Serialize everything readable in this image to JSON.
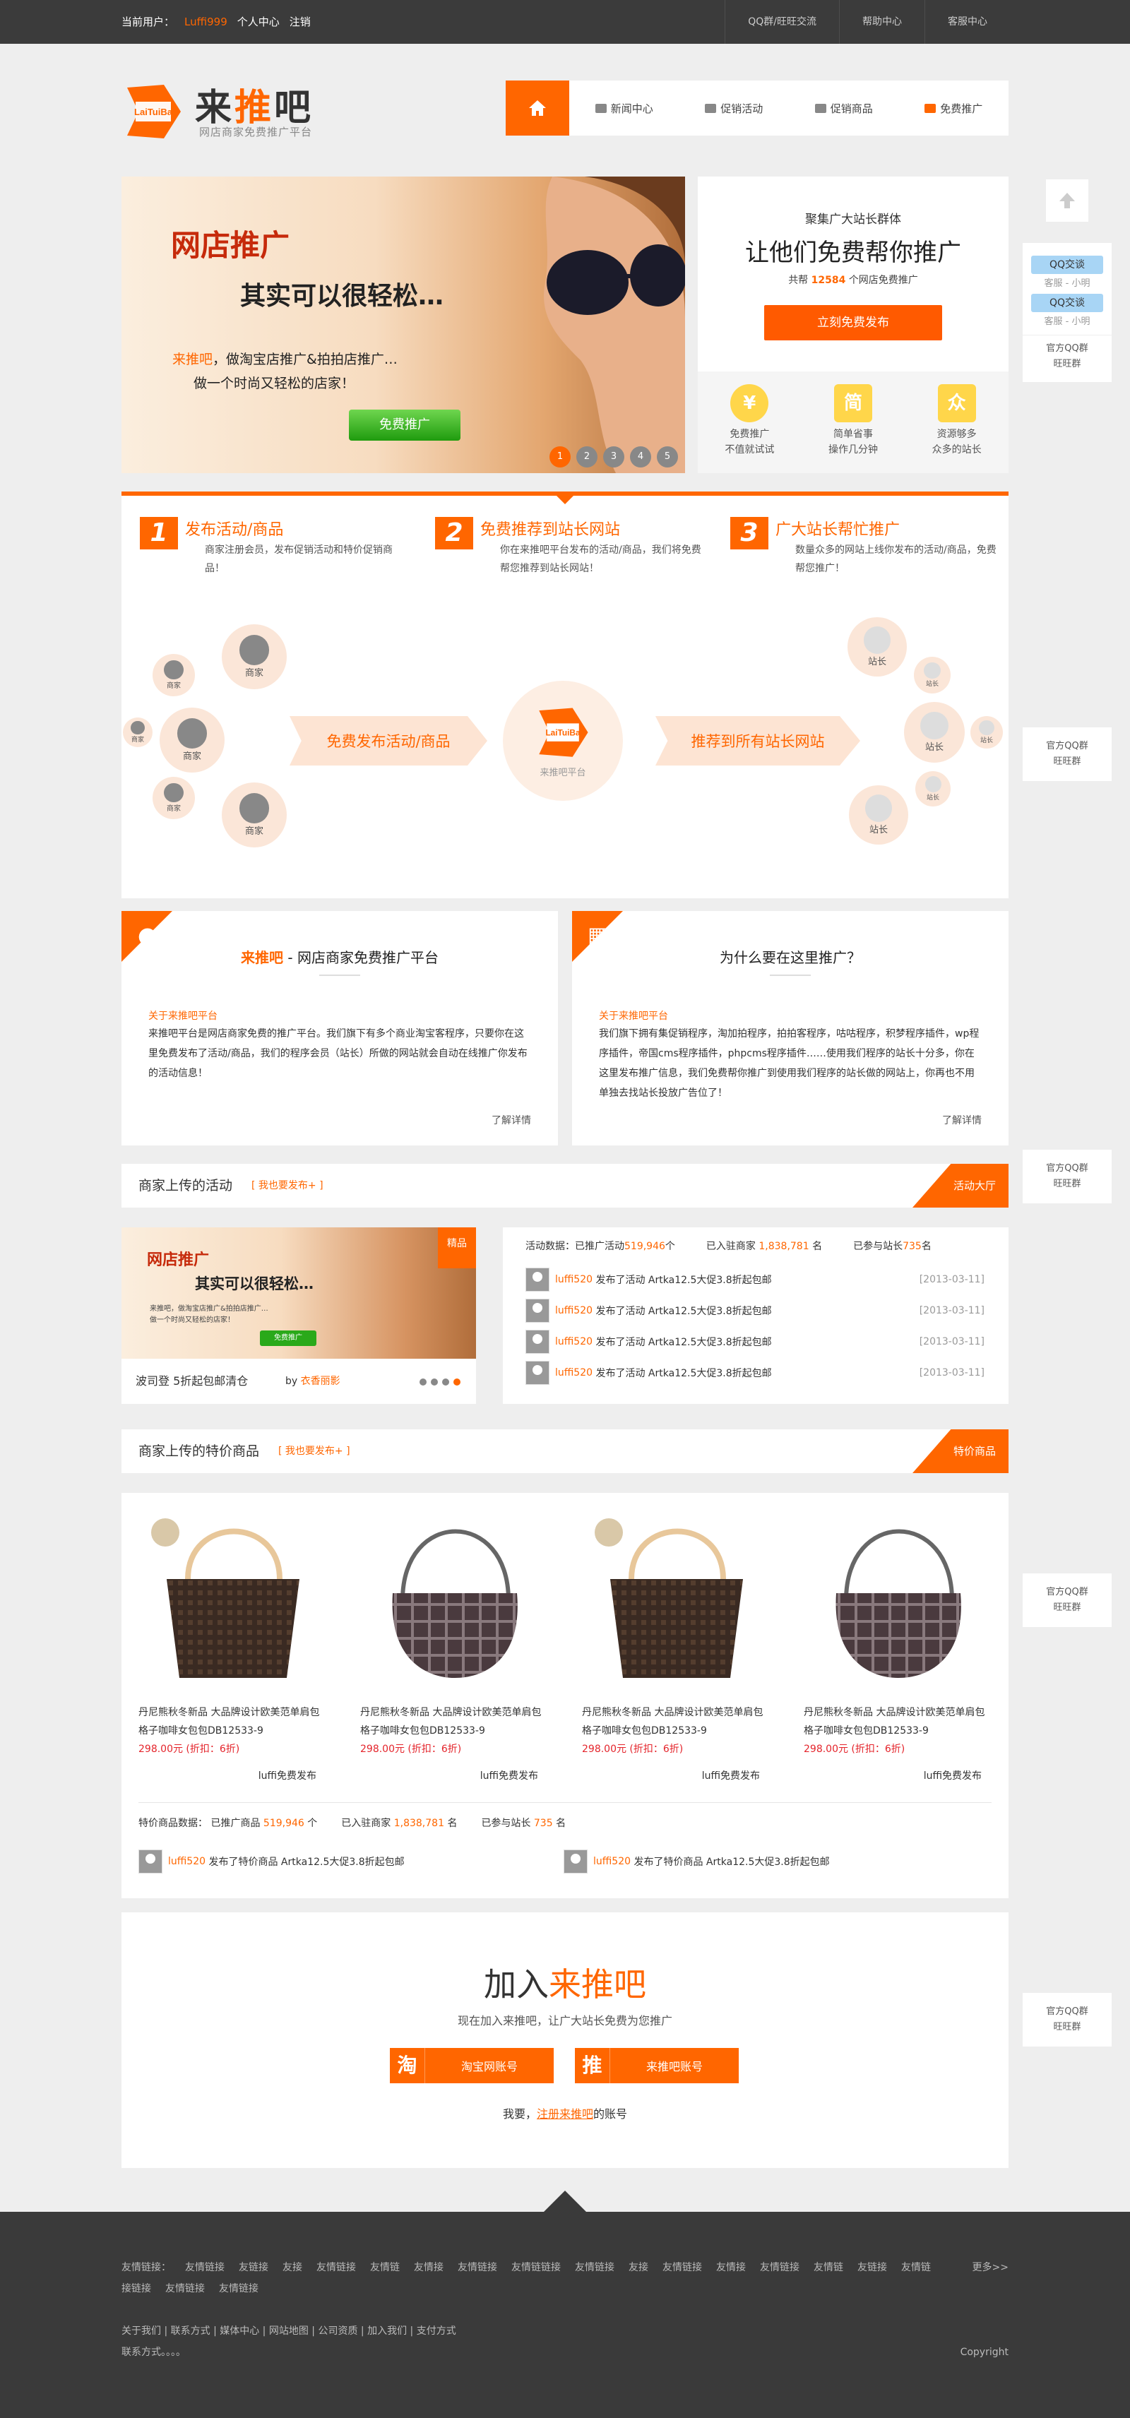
{
  "topbar": {
    "user_label": "当前用户：",
    "username": "Luffi999",
    "profile": "个人中心",
    "logout": "注销",
    "links": [
      "QQ群/旺旺交流",
      "帮助中心",
      "客服中心"
    ]
  },
  "logo": {
    "mark_text": "LaiTuiBa",
    "name_part1": "来",
    "name_part2": "推",
    "name_part3": "吧",
    "subtitle": "网店商家免费推广平台"
  },
  "nav": {
    "items": [
      "新闻中心",
      "促销活动",
      "促销商品",
      "免费推广"
    ]
  },
  "banner": {
    "title": "网店推广",
    "subtitle": "其实可以很轻松…",
    "line1_highlight": "来推吧",
    "line1_rest": "，做淘宝店推广&拍拍店推广…",
    "line2": "做一个时尚又轻松的店家！",
    "button": "免费推广",
    "pages": [
      "1",
      "2",
      "3",
      "4",
      "5"
    ]
  },
  "promo": {
    "kicker": "聚集广大站长群体",
    "headline": "让他们免费帮你推广",
    "count_prefix": "共帮",
    "count": "12584",
    "count_suffix": "个网店免费推广",
    "button": "立刻免费发布",
    "features": [
      {
        "icon": "¥",
        "line1": "免费推广",
        "line2": "不值就试试"
      },
      {
        "icon": "简",
        "line1": "简单省事",
        "line2": "操作几分钟"
      },
      {
        "icon": "众",
        "line1": "资源够多",
        "line2": "众多的站长"
      }
    ]
  },
  "steps": {
    "items": [
      {
        "num": "1",
        "title": "发布活动/商品",
        "desc": "商家注册会员，发布促销活动和特价促销商品！"
      },
      {
        "num": "2",
        "title": "免费推荐到站长网站",
        "desc": "你在来推吧平台发布的活动/商品，我们将免费帮您推荐到站长网站！"
      },
      {
        "num": "3",
        "title": "广大站长帮忙推广",
        "desc": "数量众多的网站上线你发布的活动/商品，免费帮您推广！"
      }
    ],
    "merchant": "商家",
    "webmaster": "站长",
    "band1": "免费发布活动/商品",
    "band2": "推荐到所有站长网站",
    "platform": "来推吧平台",
    "platform_mark": "LaiTuiBa"
  },
  "cards": [
    {
      "title_brand": "来推吧",
      "title_rest": " - 网店商家免费推广平台",
      "heading": "关于来推吧平台",
      "body": "来推吧平台是网店商家免费的推广平台。我们旗下有多个商业淘宝客程序，只要你在这里免费发布了活动/商品，我们的程序会员（站长）所做的网站就会自动在线推广你发布的活动信息！",
      "more": "了解详情"
    },
    {
      "title": "为什么要在这里推广？",
      "heading": "关于来推吧平台",
      "body": "我们旗下拥有集促销程序，淘加拍程序，拍拍客程序，咕咕程序，积梦程序插件，wp程序插件，帝国cms程序插件，phpcms程序插件……使用我们程序的站长十分多，你在这里发布推广信息，我们免费帮你推广到使用我们程序的站长做的网站上，你再也不用单独去找站长投放广告位了！",
      "more": "了解详情"
    }
  ],
  "activities": {
    "title": "商家上传的活动",
    "post_link": "[ 我也要发布+ ]",
    "tag": "活动大厅",
    "banner": {
      "badge": "精品",
      "t1": "网店推广",
      "t2": "其实可以很轻松…",
      "t3a": "来推吧，做淘宝店推广&拍拍店推广…",
      "t3b": "做一个时尚又轻松的店家！",
      "btn": "免费推广"
    },
    "caption": "波司登 5折起包邮清仓",
    "by": "by",
    "author": "衣香丽影",
    "stats": {
      "label": "活动数据：",
      "p1": "已推广活动",
      "v1": "519,946",
      "u1": "个",
      "p2": "已入驻商家",
      "v2": "1,838,781",
      "u2": "名",
      "p3": "已参与站长",
      "v3": "735",
      "u3": "名"
    },
    "rows": [
      {
        "user": "luffi520",
        "action": "发布了活动 Artka12.5大促3.8折起包邮",
        "date": "[2013-03-11]"
      },
      {
        "user": "luffi520",
        "action": "发布了活动 Artka12.5大促3.8折起包邮",
        "date": "[2013-03-11]"
      },
      {
        "user": "luffi520",
        "action": "发布了活动 Artka12.5大促3.8折起包邮",
        "date": "[2013-03-11]"
      },
      {
        "user": "luffi520",
        "action": "发布了活动 Artka12.5大促3.8折起包邮",
        "date": "[2013-03-11]"
      }
    ]
  },
  "products": {
    "title": "商家上传的特价商品",
    "post_link": "[ 我也要发布+ ]",
    "tag": "特价商品",
    "items": [
      {
        "title": "丹尼熊秋冬新品 大品牌设计欧美范单肩包格子咖啡女包包DB12533-9",
        "price": "298.00元 (折扣：6折)",
        "from": "luffi免费发布",
        "style": "tote"
      },
      {
        "title": "丹尼熊秋冬新品 大品牌设计欧美范单肩包格子咖啡女包包DB12533-9",
        "price": "298.00元 (折扣：6折)",
        "from": "luffi免费发布",
        "style": "hobo"
      },
      {
        "title": "丹尼熊秋冬新品 大品牌设计欧美范单肩包格子咖啡女包包DB12533-9",
        "price": "298.00元 (折扣：6折)",
        "from": "luffi免费发布",
        "style": "tote"
      },
      {
        "title": "丹尼熊秋冬新品 大品牌设计欧美范单肩包格子咖啡女包包DB12533-9",
        "price": "298.00元 (折扣：6折)",
        "from": "luffi免费发布",
        "style": "hobo"
      }
    ],
    "stats": {
      "label": "特价商品数据：",
      "p1": "已推广商品",
      "v1": "519,946",
      "u1": "个",
      "p2": "已入驻商家",
      "v2": "1,838,781",
      "u2": "名",
      "p3": "已参与站长",
      "v3": "735",
      "u3": "名"
    },
    "rows": [
      {
        "user": "luffi520",
        "action": "发布了特价商品 Artka12.5大促3.8折起包邮"
      },
      {
        "user": "luffi520",
        "action": "发布了特价商品 Artka12.5大促3.8折起包邮"
      }
    ]
  },
  "join": {
    "title_prefix": "加入",
    "title_brand": "来推吧",
    "subtitle": "现在加入来推吧，让广大站长免费为您推广",
    "btn1_icon": "淘",
    "btn1": "淘宝网账号",
    "btn2_icon": "推",
    "btn2": "来推吧账号",
    "reg_prefix": "我要，",
    "reg_link": "注册来推吧",
    "reg_suffix": "的账号"
  },
  "side": {
    "qq_btn": "QQ交谈",
    "kefu": "客服 - 小明",
    "group_line1": "官方QQ群",
    "group_line2": "旺旺群"
  },
  "footer": {
    "friends_label": "友情链接：",
    "friends": [
      "友情链接",
      "友链接",
      "友接",
      "友情链接",
      "友情链",
      "友情接",
      "友情链接",
      "友情链链接",
      "友情链接",
      "友接",
      "友情链接",
      "友情接",
      "友情链接",
      "友情链",
      "友链接",
      "友情链接链接",
      "友情链接",
      "友情链接"
    ],
    "more": "更多>>",
    "links": "关于我们 | 联系方式 | 媒体中心 | 网站地图 | 公司资质 | 加入我们 | 支付方式",
    "contact": "联系方式。。。。",
    "copyright": "Copyright"
  },
  "colors": {
    "accent": "#ff6600",
    "dark": "#3b3b3b",
    "price": "#e4242b"
  }
}
